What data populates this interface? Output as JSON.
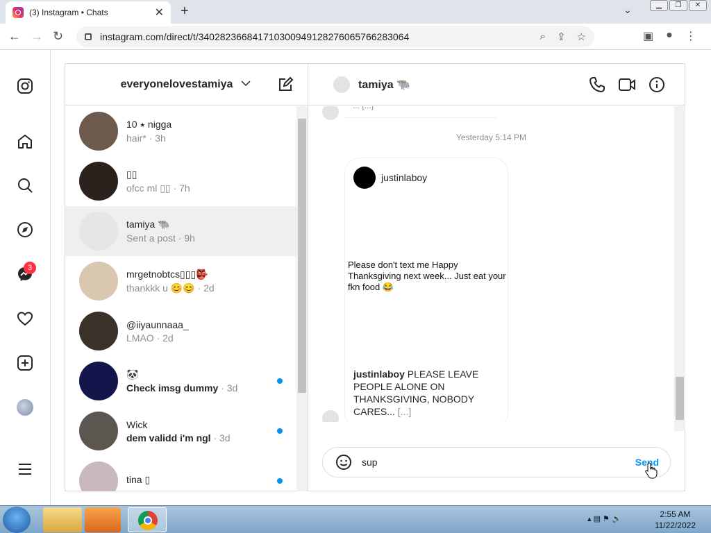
{
  "browser": {
    "tab_title": "(3) Instagram • Chats",
    "url": "instagram.com/direct/t/340282366841710300949128276065766283064"
  },
  "nav": {
    "messages_badge": "3"
  },
  "inbox": {
    "username": "everyonelovestamiya",
    "conversations": [
      {
        "name": "10 ⭑ nigga",
        "preview": "hair* · 3h",
        "unread": false,
        "selected": false,
        "color": "#6d5a4c"
      },
      {
        "name": "▯▯",
        "preview": "ofcc ml ▯▯ · 7h",
        "unread": false,
        "selected": false,
        "color": "#2b221d"
      },
      {
        "name": "tamiya 🐃",
        "preview": "Sent a post · 9h",
        "unread": false,
        "selected": true,
        "color": "#e6e6e6"
      },
      {
        "name": "mrgetnobtcs▯▯▯👺",
        "preview": "thankkk u 😊😊 · 2d",
        "unread": false,
        "selected": false,
        "color": "#d9c7b0"
      },
      {
        "name": "@iiyaunnaaa_",
        "preview": "LMAO · 2d",
        "unread": false,
        "selected": false,
        "color": "#3a3128"
      },
      {
        "name": "🐼",
        "preview_text": "Check imsg dummy",
        "preview_time": " · 3d",
        "unread": true,
        "selected": false,
        "color": "#14154a"
      },
      {
        "name": "Wick",
        "preview_text": "dem validd i'm ngl",
        "preview_time": " · 3d",
        "unread": true,
        "selected": false,
        "color": "#5c5650"
      },
      {
        "name": "tina ▯",
        "preview_text": "",
        "preview_time": "",
        "unread": true,
        "selected": false,
        "color": "#c9b8c0"
      }
    ]
  },
  "chat": {
    "contact": "tamiya 🐃",
    "timestamp": "Yesterday 5:14 PM",
    "prev_snippet": "... [...]",
    "post": {
      "author": "justinlaboy",
      "body": "Please don't text me Happy Thanksgiving next week... Just eat your fkn food 😂",
      "caption_author": "justinlaboy",
      "caption_text": " PLEASE LEAVE PEOPLE ALONE ON THANKSGIVING, NOBODY CARES...",
      "caption_more": " [...]"
    },
    "composer_value": "sup",
    "send_label": "Send"
  },
  "taskbar": {
    "time": "2:55 AM",
    "date": "11/22/2022"
  }
}
